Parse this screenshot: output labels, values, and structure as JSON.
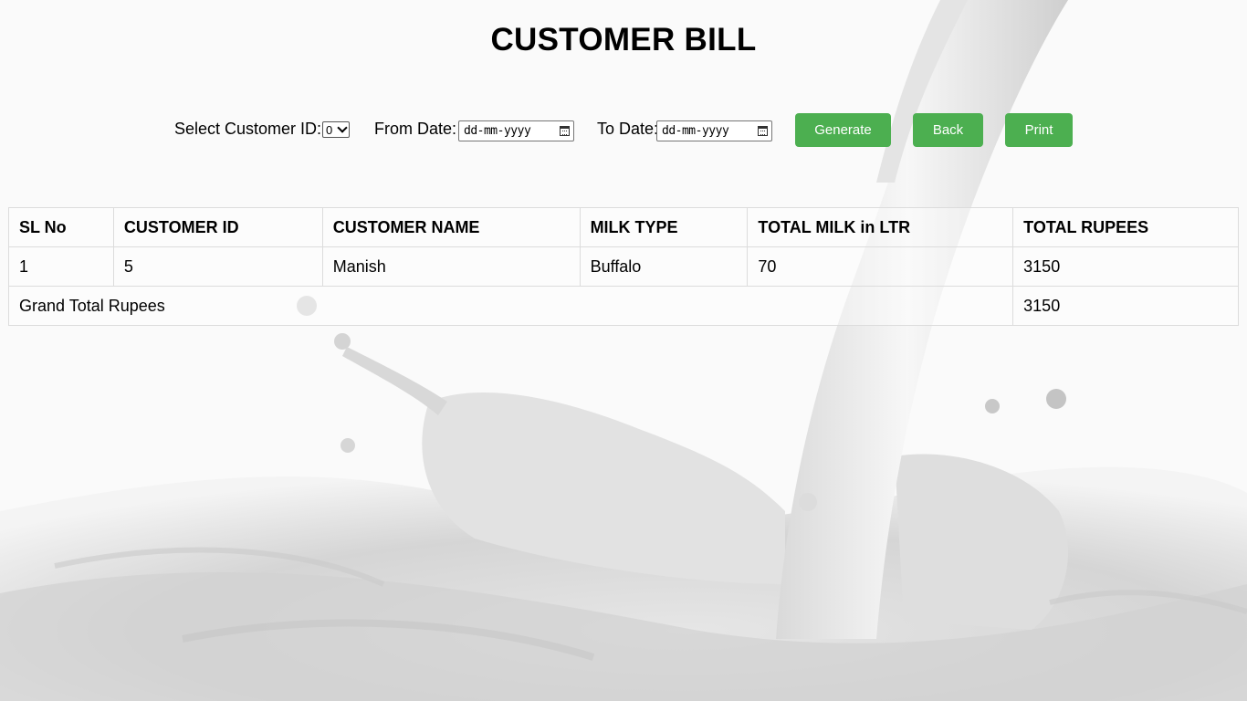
{
  "page": {
    "title": "CUSTOMER BILL"
  },
  "controls": {
    "customer_id_label": "Select Customer ID:",
    "customer_id_value": "0",
    "from_date_label": "From Date:",
    "from_date_placeholder": "dd-mm-yyyy",
    "to_date_label": "To Date:",
    "to_date_placeholder": "dd-mm-yyyy",
    "generate_label": "Generate",
    "back_label": "Back",
    "print_label": "Print"
  },
  "colors": {
    "button_bg": "#4caf50",
    "button_text": "#ffffff"
  },
  "table": {
    "headers": [
      "SL No",
      "CUSTOMER ID",
      "CUSTOMER NAME",
      "MILK TYPE",
      "TOTAL MILK in LTR",
      "TOTAL RUPEES"
    ],
    "rows": [
      [
        "1",
        "5",
        "Manish",
        "Buffalo",
        "70",
        "3150"
      ]
    ],
    "grand_total_label": "Grand Total Rupees",
    "grand_total_value": "3150"
  },
  "icons": {
    "calendar": "calendar-icon",
    "dropdown": "chevron-down-icon"
  }
}
